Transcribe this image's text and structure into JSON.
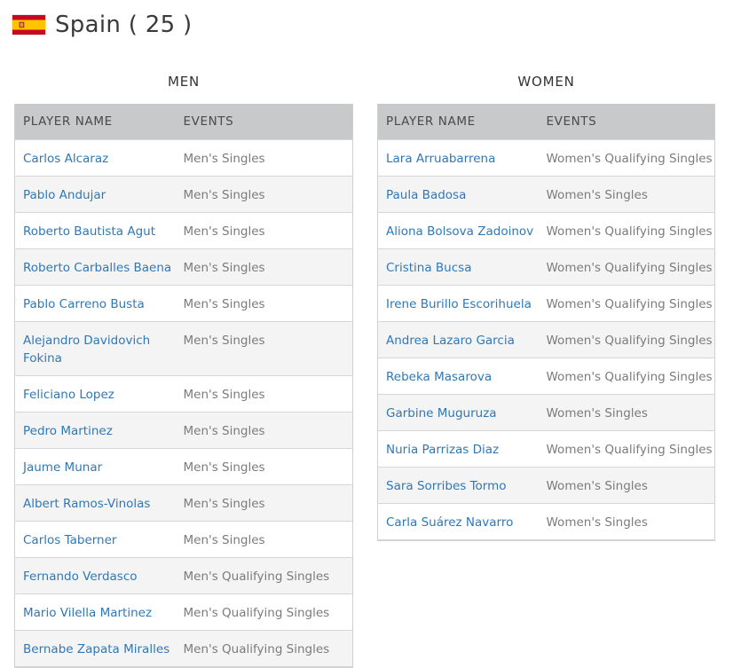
{
  "page": {
    "country": "Spain",
    "count_display": "( 25 )",
    "flag": {
      "name": "spain-flag-icon",
      "colors": {
        "red": "#c60b1e",
        "yellow": "#ffc400"
      }
    }
  },
  "columns": {
    "player": "PLAYER NAME",
    "events": "EVENTS"
  },
  "men": {
    "title": "MEN",
    "rows": [
      {
        "name": "Carlos Alcaraz",
        "event": "Men's Singles"
      },
      {
        "name": "Pablo Andujar",
        "event": "Men's Singles"
      },
      {
        "name": "Roberto Bautista Agut",
        "event": "Men's Singles"
      },
      {
        "name": "Roberto Carballes Baena",
        "event": "Men's Singles"
      },
      {
        "name": "Pablo Carreno Busta",
        "event": "Men's Singles"
      },
      {
        "name": "Alejandro Davidovich Fokina",
        "event": "Men's Singles"
      },
      {
        "name": "Feliciano Lopez",
        "event": "Men's Singles"
      },
      {
        "name": "Pedro Martinez",
        "event": "Men's Singles"
      },
      {
        "name": "Jaume Munar",
        "event": "Men's Singles"
      },
      {
        "name": "Albert Ramos-Vinolas",
        "event": "Men's Singles"
      },
      {
        "name": "Carlos Taberner",
        "event": "Men's Singles"
      },
      {
        "name": "Fernando Verdasco",
        "event": "Men's Qualifying Singles"
      },
      {
        "name": "Mario Vilella Martinez",
        "event": "Men's Qualifying Singles"
      },
      {
        "name": "Bernabe Zapata Miralles",
        "event": "Men's Qualifying Singles"
      }
    ]
  },
  "women": {
    "title": "WOMEN",
    "rows": [
      {
        "name": "Lara Arruabarrena",
        "event": "Women's Qualifying Singles"
      },
      {
        "name": "Paula Badosa",
        "event": "Women's Singles"
      },
      {
        "name": "Aliona Bolsova Zadoinov",
        "event": "Women's Qualifying Singles"
      },
      {
        "name": "Cristina Bucsa",
        "event": "Women's Qualifying Singles"
      },
      {
        "name": "Irene Burillo Escorihuela",
        "event": "Women's Qualifying Singles"
      },
      {
        "name": "Andrea Lazaro Garcia",
        "event": "Women's Qualifying Singles"
      },
      {
        "name": "Rebeka Masarova",
        "event": "Women's Qualifying Singles"
      },
      {
        "name": "Garbine Muguruza",
        "event": "Women's Singles"
      },
      {
        "name": "Nuria Parrizas Diaz",
        "event": "Women's Qualifying Singles"
      },
      {
        "name": "Sara Sorribes Tormo",
        "event": "Women's Singles"
      },
      {
        "name": "Carla Suárez Navarro",
        "event": "Women's Singles"
      }
    ]
  }
}
